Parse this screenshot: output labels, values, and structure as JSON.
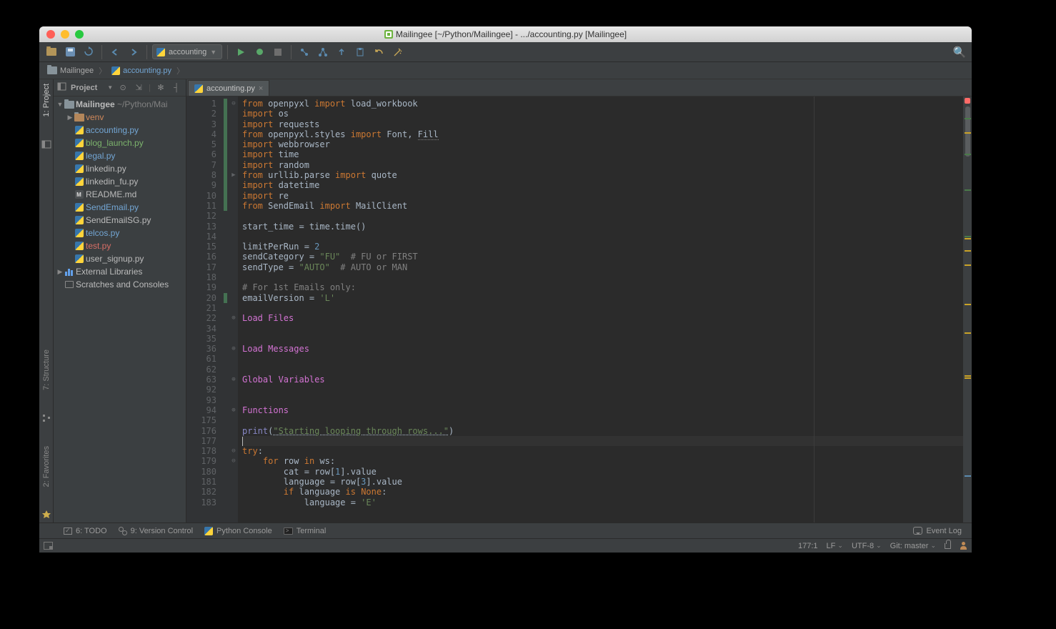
{
  "window": {
    "title": "Mailingee [~/Python/Mailingee] - .../accounting.py [Mailingee]"
  },
  "breadcrumb": {
    "root": "Mailingee",
    "file": "accounting.py"
  },
  "runConfig": {
    "name": "accounting"
  },
  "projectPanel": {
    "title": "Project"
  },
  "tree": {
    "root": {
      "name": "Mailingee",
      "path": "~/Python/Mai"
    },
    "venv": "venv",
    "files": [
      "accounting.py",
      "blog_launch.py",
      "legal.py",
      "linkedin.py",
      "linkedin_fu.py",
      "README.md",
      "SendEmail.py",
      "SendEmailSG.py",
      "telcos.py",
      "test.py",
      "user_signup.py"
    ],
    "extLib": "External Libraries",
    "scratch": "Scratches and Consoles"
  },
  "sideTabs": {
    "project": "1: Project",
    "structure": "7: Structure",
    "favorites": "2: Favorites"
  },
  "editorTab": {
    "name": "accounting.py"
  },
  "code": {
    "lineNumbers": [
      1,
      2,
      3,
      4,
      5,
      6,
      7,
      8,
      9,
      10,
      11,
      12,
      13,
      14,
      15,
      16,
      17,
      18,
      19,
      20,
      21,
      22,
      34,
      35,
      36,
      61,
      62,
      63,
      92,
      93,
      94,
      175,
      176,
      177,
      178,
      179,
      180,
      181,
      182,
      183
    ],
    "l1a": "from ",
    "l1b": "openpyxl ",
    "l1c": "import ",
    "l1d": "load_workbook",
    "l2a": "import ",
    "l2b": "os",
    "l3a": "import ",
    "l3b": "requests",
    "l4a": "from ",
    "l4b": "openpyxl.styles ",
    "l4c": "import ",
    "l4d": "Font",
    "l4e": ", ",
    "l4f": "Fill",
    "l5a": "import ",
    "l5b": "webbrowser",
    "l6a": "import ",
    "l6b": "time",
    "l7a": "import ",
    "l7b": "random",
    "l8a": "from ",
    "l8b": "urllib.parse ",
    "l8c": "import ",
    "l8d": "quote",
    "l9a": "import ",
    "l9b": "datetime",
    "l10a": "import ",
    "l10b": "re",
    "l11a": "from ",
    "l11b": "SendEmail ",
    "l11c": "import ",
    "l11d": "MailClient",
    "l13": "start_time = time.time()",
    "l15a": "limitPerRun = ",
    "l15b": "2",
    "l16a": "sendCategory = ",
    "l16b": "\"FU\"",
    "l16c": "  # FU or FIRST",
    "l17a": "sendType = ",
    "l17b": "\"AUTO\"",
    "l17c": "  # AUTO or MAN",
    "l19": "# For 1st Emails only:",
    "l20a": "emailVersion = ",
    "l20b": "'L'",
    "l22": "Load Files",
    "l36": "Load Messages",
    "l63": "Global Variables",
    "l94": "Functions",
    "l176a": "print",
    "l176b": "(",
    "l176c": "\"Starting looping through rows...\"",
    "l176d": ")",
    "l178a": "try",
    "l178b": ":",
    "l179a": "    ",
    "l179b": "for ",
    "l179c": "row ",
    "l179d": "in ",
    "l179e": "ws:",
    "l180a": "        cat = row[",
    "l180b": "1",
    "l180c": "].value",
    "l181a": "        language = row[",
    "l181b": "3",
    "l181c": "].value",
    "l182a": "        ",
    "l182b": "if ",
    "l182c": "language ",
    "l182d": "is ",
    "l182e": "None",
    "l182f": ":",
    "l183a": "            language = ",
    "l183b": "'E'"
  },
  "bottomBar": {
    "todo": "6: TODO",
    "vcs": "9: Version Control",
    "pyconsole": "Python Console",
    "terminal": "Terminal",
    "eventlog": "Event Log"
  },
  "statusBar": {
    "pos": "177:1",
    "lineEnding": "LF",
    "encoding": "UTF-8",
    "git": "Git: master"
  }
}
